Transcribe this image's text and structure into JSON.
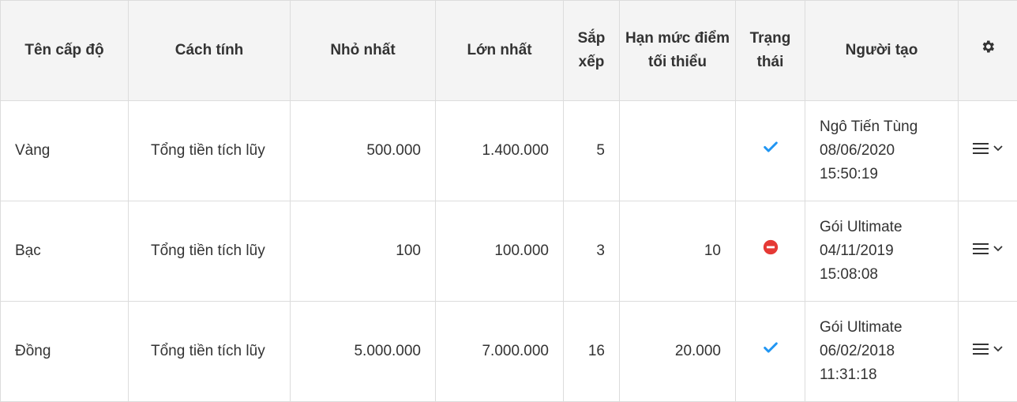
{
  "table": {
    "headers": {
      "name": "Tên cấp độ",
      "method": "Cách tính",
      "min": "Nhỏ nhất",
      "max": "Lớn nhất",
      "sort": "Sắp xếp",
      "limit": "Hạn mức điểm tối thiểu",
      "status": "Trạng thái",
      "creator": "Người tạo",
      "settings_icon": "gear-icon"
    },
    "rows": [
      {
        "name": "Vàng",
        "method": "Tổng tiền tích lũy",
        "min": "500.000",
        "max": "1.400.000",
        "sort": "5",
        "limit": "",
        "status": "active",
        "creator_name": "Ngô Tiến Tùng",
        "creator_date": "08/06/2020",
        "creator_time": "15:50:19"
      },
      {
        "name": "Bạc",
        "method": "Tổng tiền tích lũy",
        "min": "100",
        "max": "100.000",
        "sort": "3",
        "limit": "10",
        "status": "inactive",
        "creator_name": "Gói Ultimate",
        "creator_date": "04/11/2019",
        "creator_time": "15:08:08"
      },
      {
        "name": "Đồng",
        "method": "Tổng tiền tích lũy",
        "min": "5.000.000",
        "max": "7.000.000",
        "sort": "16",
        "limit": "20.000",
        "status": "active",
        "creator_name": "Gói Ultimate",
        "creator_date": "06/02/2018",
        "creator_time": "11:31:18"
      }
    ]
  },
  "colors": {
    "check": "#2196f3",
    "block": "#e53935",
    "header_bg": "#f4f4f4",
    "border": "#dcdcdc"
  }
}
